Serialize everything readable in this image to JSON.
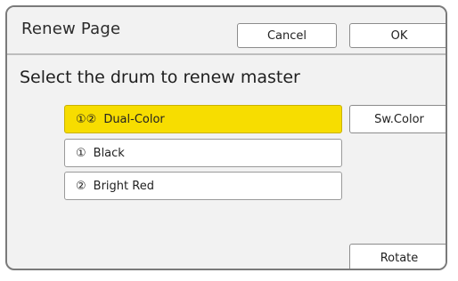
{
  "dialog": {
    "title": "Renew Page",
    "cancel_label": "Cancel",
    "ok_label": "OK",
    "prompt": "Select the drum to renew master"
  },
  "options": [
    {
      "number": "①②",
      "label": "Dual-Color",
      "selected": true
    },
    {
      "number": "①",
      "label": "Black",
      "selected": false
    },
    {
      "number": "②",
      "label": "Bright Red",
      "selected": false
    }
  ],
  "side_buttons": {
    "sw_color_label": "Sw.Color",
    "rotate_label": "Rotate"
  },
  "colors": {
    "selected_bg": "#f7dd00",
    "panel_bg": "#f2f2f2",
    "border": "#7a7a7a"
  }
}
